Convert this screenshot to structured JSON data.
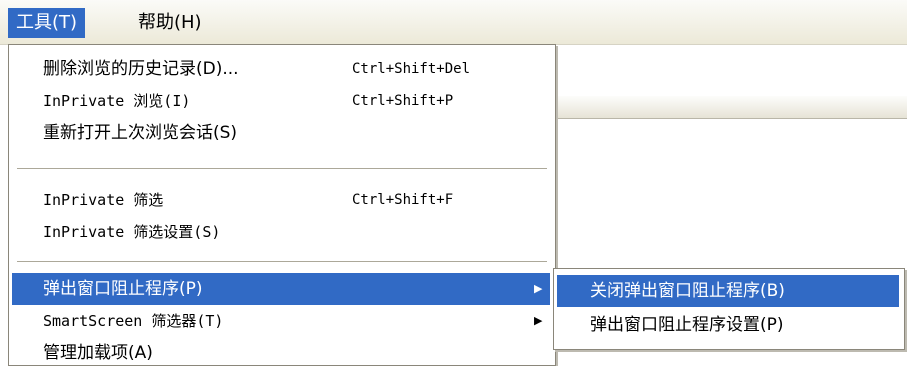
{
  "menubar": {
    "tools": "工具(T)",
    "help": "帮助(H)"
  },
  "tools_menu": {
    "delete_history": {
      "label": "删除浏览的历史记录(D)...",
      "shortcut": "Ctrl+Shift+Del"
    },
    "inprivate_browsing": {
      "label": "InPrivate 浏览(I)",
      "shortcut": "Ctrl+Shift+P"
    },
    "reopen_last_session": {
      "label": "重新打开上次浏览会话(S)"
    },
    "inprivate_filtering": {
      "label": "InPrivate 筛选",
      "shortcut": "Ctrl+Shift+F"
    },
    "inprivate_filter_settings": {
      "label": "InPrivate 筛选设置(S)"
    },
    "popup_blocker": {
      "label": "弹出窗口阻止程序(P)",
      "arrow": "▶"
    },
    "smartscreen_filter": {
      "label": "SmartScreen 筛选器(T)",
      "arrow": "▶"
    },
    "manage_addons": {
      "label": "管理加载项(A)"
    }
  },
  "popup_submenu": {
    "turn_off": "关闭弹出窗口阻止程序(B)",
    "settings": "弹出窗口阻止程序设置(P)"
  }
}
